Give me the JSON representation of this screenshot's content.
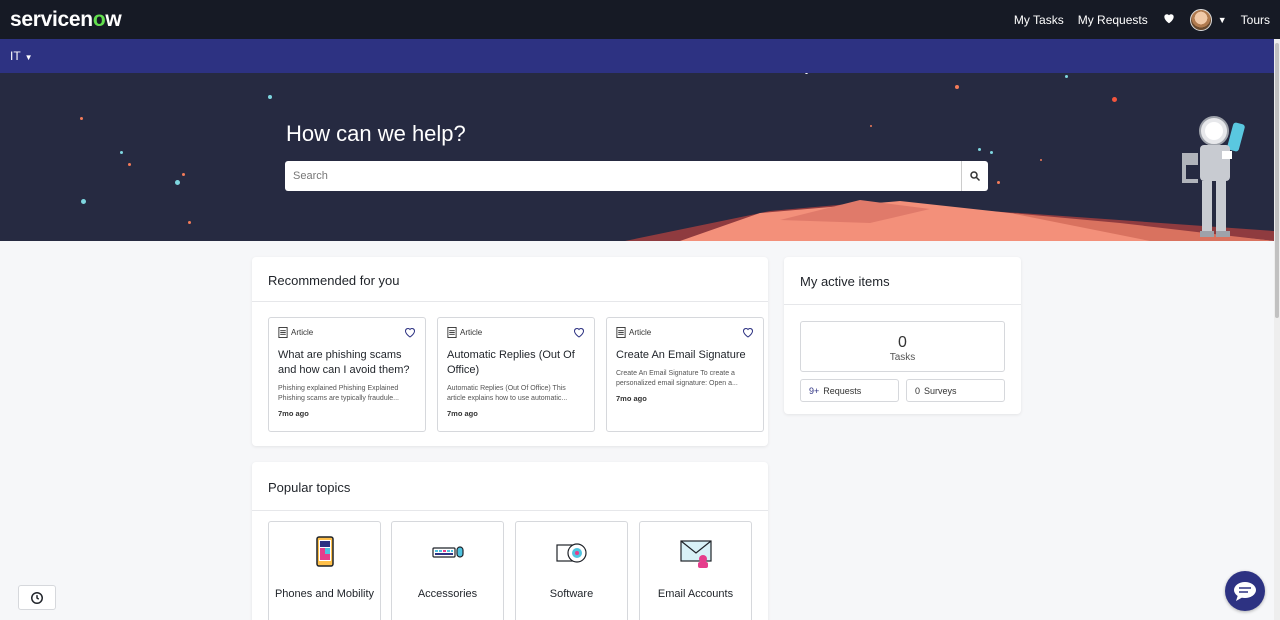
{
  "app": {
    "logo_text_pre": "servicen",
    "logo_text_o": "o",
    "logo_text_post": "w"
  },
  "topnav": {
    "my_tasks": "My Tasks",
    "my_requests": "My Requests",
    "tours": "Tours"
  },
  "secondary_nav": {
    "portal_label": "IT"
  },
  "hero": {
    "heading": "How can we help?",
    "search_placeholder": "Search"
  },
  "recommended": {
    "title": "Recommended for you",
    "items": [
      {
        "type": "Article",
        "title": "What are phishing scams and how can I avoid them?",
        "description": "Phishing explained Phishing Explained Phishing scams are typically fraudule...",
        "time": "7mo ago"
      },
      {
        "type": "Article",
        "title": "Automatic Replies (Out Of Office)",
        "description": "Automatic Replies (Out Of Office) This article explains how to use automatic...",
        "time": "7mo ago"
      },
      {
        "type": "Article",
        "title": "Create An Email Signature",
        "description": "Create An Email Signature To create a personalized email signature: Open a...",
        "time": "7mo ago"
      }
    ]
  },
  "active_items": {
    "title": "My active items",
    "tasks_count": "0",
    "tasks_label": "Tasks",
    "requests_count": "9+",
    "requests_label": "Requests",
    "surveys_count": "0",
    "surveys_label": "Surveys"
  },
  "popular_topics": {
    "title": "Popular topics",
    "items": [
      {
        "label": "Phones and Mobility",
        "icon": "phone-icon"
      },
      {
        "label": "Accessories",
        "icon": "keyboard-mouse-icon"
      },
      {
        "label": "Software",
        "icon": "software-disc-icon"
      },
      {
        "label": "Email Accounts",
        "icon": "email-icon"
      }
    ]
  },
  "colors": {
    "topbar": "#161a25",
    "secondary_bar": "#2d3282",
    "hero": "#262a41",
    "brand_green": "#63df4e"
  }
}
